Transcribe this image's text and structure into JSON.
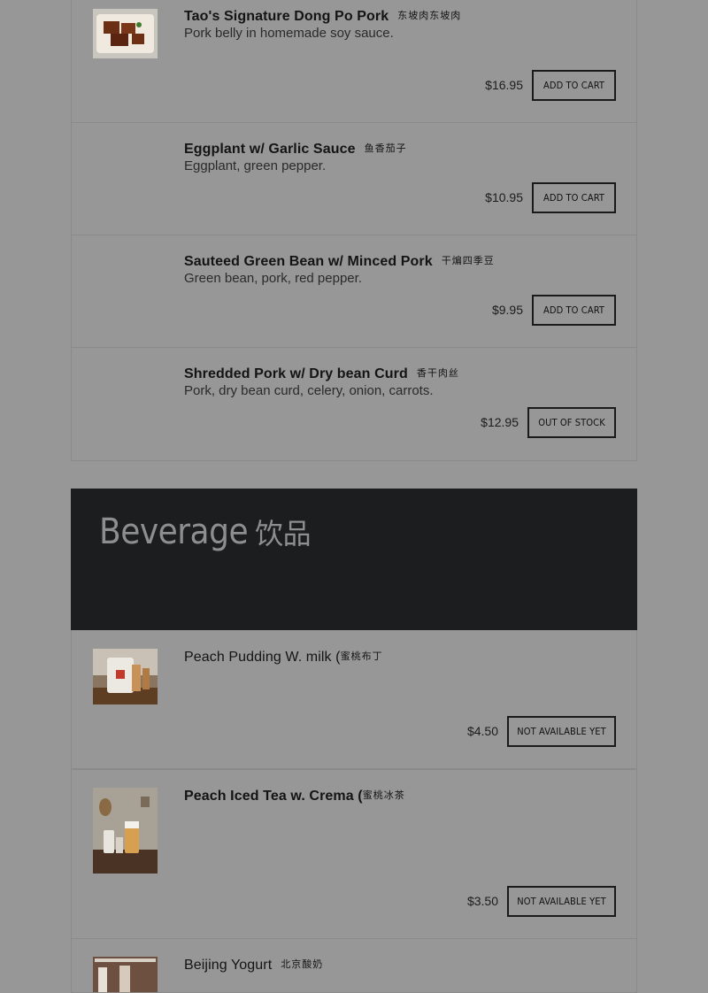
{
  "items": [
    {
      "name": "Tao's Signature Dong Po Pork",
      "cjk": "东坡肉东坡肉",
      "desc": "Pork belly in homemade soy sauce.",
      "price": "$16.95",
      "button": "Add to cart"
    },
    {
      "name": "Eggplant w/ Garlic Sauce",
      "cjk": "鱼香茄子",
      "desc": "Eggplant, green pepper.",
      "price": "$10.95",
      "button": "Add to cart"
    },
    {
      "name": "Sauteed Green Bean w/ Minced Pork",
      "cjk": "干煸四季豆",
      "desc": "Green bean, pork, red pepper.",
      "price": "$9.95",
      "button": "Add to cart"
    },
    {
      "name": "Shredded Pork w/ Dry bean Curd",
      "cjk": "香干肉丝",
      "desc": "Pork, dry bean curd, celery, onion, carrots.",
      "price": "$12.95",
      "button": "Out of stock"
    }
  ],
  "beverage_section": {
    "title": "Beverage",
    "cjk": "饮品"
  },
  "beverages": [
    {
      "name": "Peach Pudding W. milk (",
      "cjk": "蜜桃布丁",
      "price": "$4.50",
      "button": "Not available yet"
    },
    {
      "name": "Peach Iced Tea w. Crema (",
      "cjk": "蜜桃冰茶",
      "price": "$3.50",
      "button": "Not available yet"
    },
    {
      "name": "Beijing Yogurt",
      "cjk": "北京酸奶"
    }
  ]
}
